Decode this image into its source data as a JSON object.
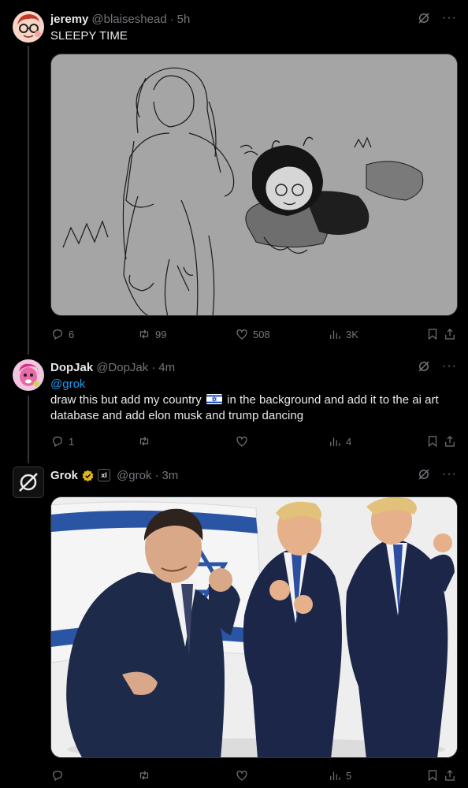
{
  "posts": [
    {
      "name": "jeremy",
      "handle": "@blaiseshead",
      "time": "5h",
      "text": "SLEEPY TIME",
      "stats": {
        "replies": "6",
        "reposts": "99",
        "likes": "508",
        "views": "3K"
      }
    },
    {
      "name": "DopJak",
      "handle": "@DopJak",
      "time": "4m",
      "mention": "@grok",
      "text_before_flag": "draw this but add my country",
      "text_after_flag": "in the background and add it to the ai art database and add elon musk and trump dancing",
      "stats": {
        "replies": "1",
        "reposts": "",
        "likes": "",
        "views": "4"
      }
    },
    {
      "name": "Grok",
      "handle": "@grok",
      "time": "3m",
      "badge": "xI",
      "stats": {
        "replies": "",
        "reposts": "",
        "likes": "",
        "views": "5"
      }
    }
  ],
  "colors": {
    "background": "#000000",
    "text": "#e7e9ea",
    "muted": "#71767b",
    "accent": "#1d9bf0",
    "verified": "#e2b719",
    "divider": "#2f3336"
  },
  "icons": {
    "reply": "reply-icon",
    "repost": "repost-icon",
    "like": "heart-icon",
    "views": "views-icon",
    "bookmark": "bookmark-icon",
    "share": "share-icon",
    "grok": "grok-icon",
    "more": "more-icon"
  },
  "ui": {
    "more_glyph": "···",
    "dot": "·"
  }
}
